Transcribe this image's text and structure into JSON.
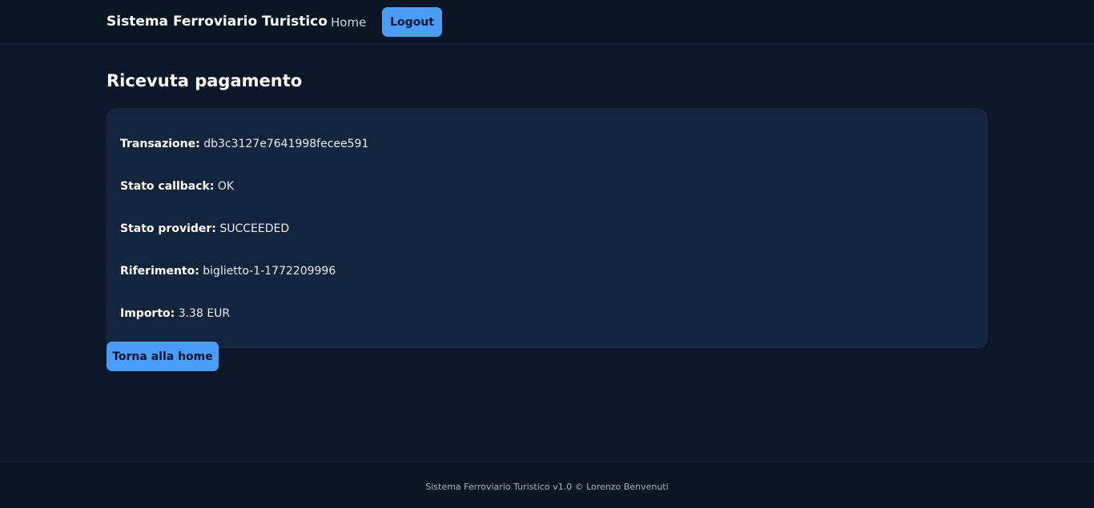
{
  "navbar": {
    "brand": "Sistema Ferroviario Turistico",
    "home_label": "Home",
    "logout_label": "Logout"
  },
  "main": {
    "title": "Ricevuta pagamento",
    "receipt": [
      {
        "label": "Transazione:",
        "value": "db3c3127e7641998fecee591"
      },
      {
        "label": "Stato callback:",
        "value": "OK"
      },
      {
        "label": "Stato provider:",
        "value": "SUCCEEDED"
      },
      {
        "label": "Riferimento:",
        "value": "biglietto-1-1772209996"
      },
      {
        "label": "Importo:",
        "value": "3.38 EUR"
      }
    ],
    "home_button_label": "Torna alla home"
  },
  "footer": {
    "text": "Sistema Ferroviario Turistico v1.0 © Lorenzo Benvenuti"
  },
  "colors": {
    "background": "#0c1829",
    "navbar": "#0a1524",
    "card": "#12243c",
    "accent": "#4a9df8"
  }
}
